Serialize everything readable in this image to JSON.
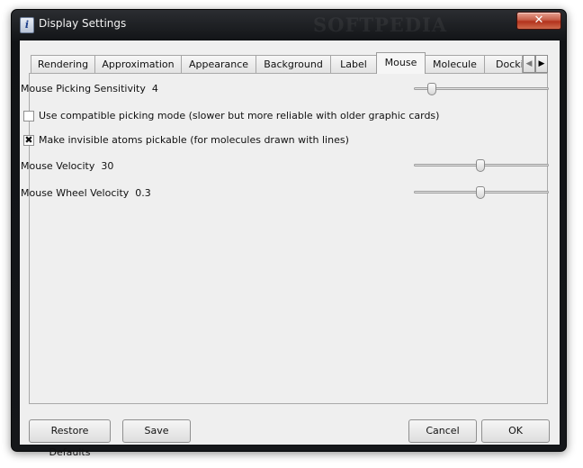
{
  "window": {
    "title": "Display Settings",
    "watermark": "SOFTPEDIA",
    "close_symbol": "✕"
  },
  "tabs": [
    {
      "label": "Rendering",
      "active": false
    },
    {
      "label": "Approximation",
      "active": false
    },
    {
      "label": "Appearance",
      "active": false
    },
    {
      "label": "Background",
      "active": false
    },
    {
      "label": "Label",
      "active": false
    },
    {
      "label": "Mouse",
      "active": true
    },
    {
      "label": "Molecule",
      "active": false
    },
    {
      "label": "Docki",
      "active": false
    }
  ],
  "tab_scroll": {
    "left_symbol": "◀",
    "right_symbol": "▶"
  },
  "mouse_panel": {
    "picking_sensitivity": {
      "label": "Mouse Picking Sensitivity",
      "value": "4",
      "slider_fraction": 0.13
    },
    "compatible_picking": {
      "label": "Use compatible picking mode (slower but more reliable with older graphic cards)",
      "checked": false
    },
    "invisible_atoms": {
      "label": "Make invisible atoms pickable (for molecules drawn with lines)",
      "checked": true,
      "check_mark": "✖"
    },
    "mouse_velocity": {
      "label": "Mouse Velocity",
      "value": "30",
      "slider_fraction": 0.49
    },
    "wheel_velocity": {
      "label": "Mouse Wheel Velocity",
      "value": "0.3",
      "slider_fraction": 0.49
    }
  },
  "buttons": {
    "restore": "Restore Defaults",
    "save": "Save",
    "cancel": "Cancel",
    "ok": "OK"
  }
}
